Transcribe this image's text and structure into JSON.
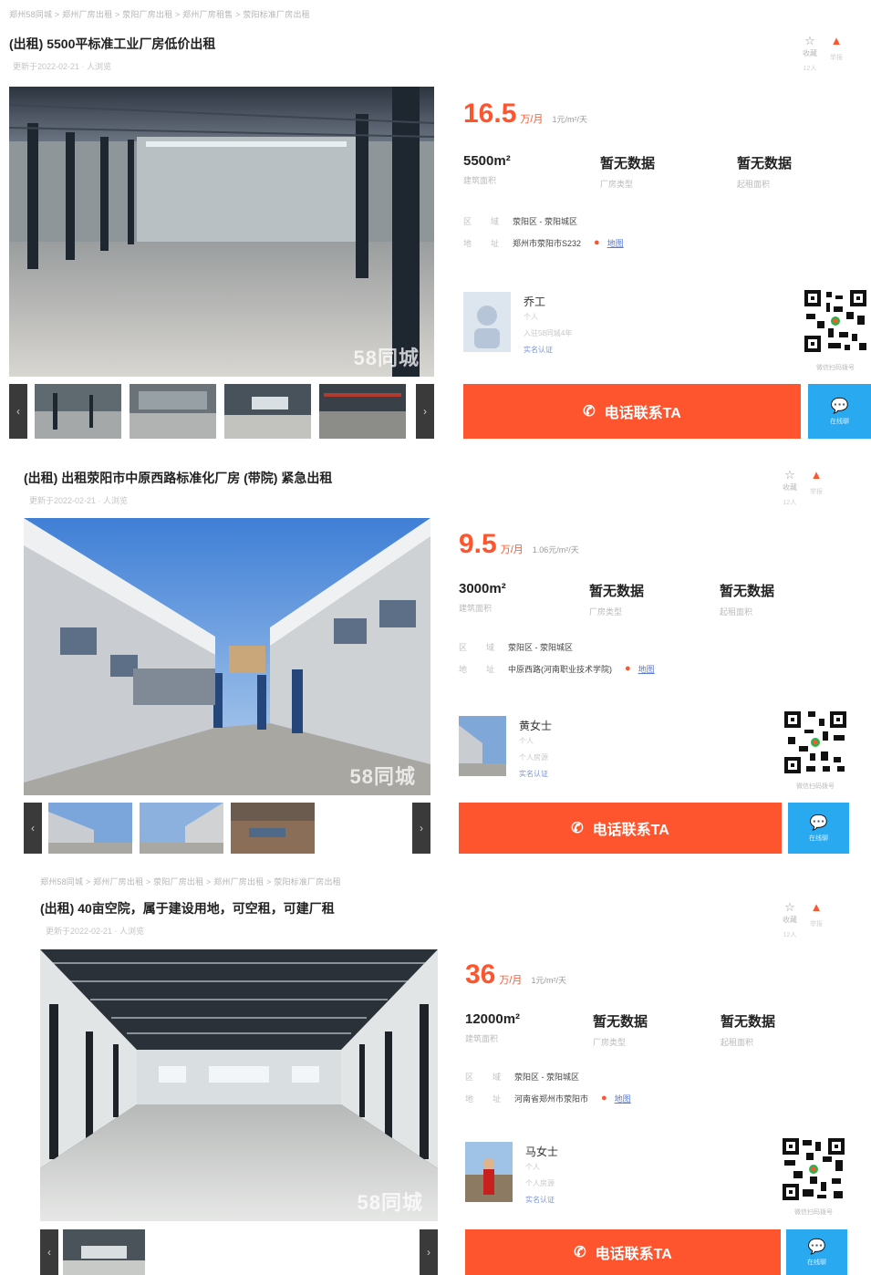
{
  "breadcrumb_top": "郑州58同城 > 郑州厂房出租 > 荥阳厂房出租 > 郑州厂房租售 > 荥阳标准厂房出租",
  "breadcrumb_mid": "郑州58同城 > 郑州厂房出租 > 荥阳厂房出租 > 郑州厂房出租 > 荥阳标准厂房出租",
  "tools": {
    "favorite": "收藏",
    "favorite_count": "12人",
    "report": "举报",
    "report_sub": "举报"
  },
  "listings": [
    {
      "title": "(出租) 5500平标准工业厂房低价出租",
      "meta": "更新于2022-02-21 · 人浏览",
      "watermark": "58同城",
      "price": "16.5",
      "price_unit": "万/月",
      "unit_price": "1元/m²/天",
      "specs": [
        {
          "value": "5500m²",
          "label": "建筑面积"
        },
        {
          "value": "暂无数据",
          "label": "厂房类型"
        },
        {
          "value": "暂无数据",
          "label": "起租面积"
        }
      ],
      "area_key1": "区",
      "area_key2": "域",
      "area": "荥阳区 - 荥阳城区",
      "addr_key1": "地",
      "addr_key2": "址",
      "address": "郑州市荥阳市S232",
      "map_label": "地图",
      "agent_name": "乔工",
      "agent_role": "个人",
      "agent_shop": "入驻58同城4年",
      "agent_badge": "实名认证",
      "qr_caption": "微信扫码拨号",
      "call_label": "电话联系TA",
      "im_label": "在线聊"
    },
    {
      "title": "(出租) 出租荥阳市中原西路标准化厂房 (带院) 紧急出租",
      "meta": "更新于2022-02-21 · 人浏览",
      "watermark": "58同城",
      "price": "9.5",
      "price_unit": "万/月",
      "unit_price": "1.06元/m²/天",
      "specs": [
        {
          "value": "3000m²",
          "label": "建筑面积"
        },
        {
          "value": "暂无数据",
          "label": "厂房类型"
        },
        {
          "value": "暂无数据",
          "label": "起租面积"
        }
      ],
      "area_key1": "区",
      "area_key2": "域",
      "area": "荥阳区 - 荥阳城区",
      "addr_key1": "地",
      "addr_key2": "址",
      "address": "中原西路(河南职业技术学院)",
      "map_label": "地图",
      "agent_name": "黄女士",
      "agent_role": "个人",
      "agent_shop": "个人房源",
      "agent_badge": "实名认证",
      "qr_caption": "微信扫码拨号",
      "call_label": "电话联系TA",
      "im_label": "在线聊"
    },
    {
      "title": "(出租) 40亩空院，属于建设用地，可空租，可建厂租",
      "meta": "更新于2022-02-21 · 人浏览",
      "watermark": "58同城",
      "price": "36",
      "price_unit": "万/月",
      "unit_price": "1元/m²/天",
      "specs": [
        {
          "value": "12000m²",
          "label": "建筑面积"
        },
        {
          "value": "暂无数据",
          "label": "厂房类型"
        },
        {
          "value": "暂无数据",
          "label": "起租面积"
        }
      ],
      "area_key1": "区",
      "area_key2": "域",
      "area": "荥阳区 - 荥阳城区",
      "addr_key1": "地",
      "addr_key2": "址",
      "address": "河南省郑州市荥阳市",
      "map_label": "地图",
      "agent_name": "马女士",
      "agent_role": "个人",
      "agent_shop": "个人房源",
      "agent_badge": "实名认证",
      "qr_caption": "微信扫码拨号",
      "call_label": "电话联系TA",
      "im_label": "在线聊"
    }
  ],
  "nav_prev": "‹",
  "nav_next": "›",
  "icons": {
    "star": "star-icon",
    "report": "report-icon",
    "phone": "phone-icon",
    "chat": "chat-icon",
    "pin": "location-pin-icon"
  },
  "colors": {
    "accent": "#ff552e",
    "chat": "#29a9f0",
    "link": "#5a7ad6"
  }
}
